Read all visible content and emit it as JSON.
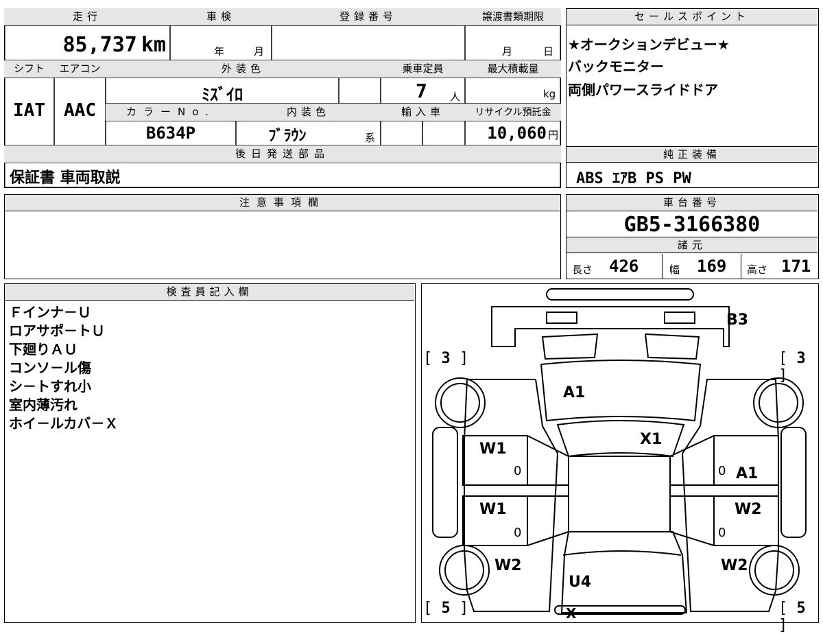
{
  "top_left": {
    "h_mileage": "走行",
    "h_inspection": "車検",
    "h_reg_no": "登録番号",
    "h_transfer_deadline": "譲渡書類期限",
    "mileage": "85,737",
    "mileage_unit": "km",
    "year_label": "年",
    "month_label": "月",
    "deadline_month": "月",
    "deadline_day": "日",
    "h_shift": "シフト",
    "h_aircon": "エアコン",
    "h_exterior": "外装色",
    "h_capacity": "乗車定員",
    "h_max_load": "最大積載量",
    "shift": "IAT",
    "aircon": "AAC",
    "exterior_color": "ﾐｽﾞｲﾛ",
    "capacity": "7",
    "capacity_unit": "人",
    "load_unit": "kg",
    "h_color_no": "カラーNo.",
    "h_interior": "内装色",
    "h_import": "輸入車",
    "h_recycle": "リサイクル預託金",
    "color_no": "B634P",
    "interior_color": "ﾌﾞﾗｳﾝ",
    "interior_suffix": "系",
    "recycle_fee": "10,060",
    "recycle_unit": "円",
    "h_later_parts": "後日発送部品",
    "later_parts": "保証書 車両取説"
  },
  "sales": {
    "h_sales_points": "セールスポイント",
    "points": [
      "★オークションデビュー★",
      "バックモニター",
      "両側パワースライドドア"
    ],
    "h_standard": "純正装備",
    "standard_equipment": "ABS ｴｱB PS PW"
  },
  "notes": {
    "h_notes": "注意事項欄"
  },
  "chassis": {
    "h_chassis": "車台番号",
    "chassis_no": "GB5-3166380",
    "h_specs": "諸元",
    "length_label": "長さ",
    "length": "426",
    "width_label": "幅",
    "width": "169",
    "height_label": "高さ",
    "height": "171"
  },
  "inspector": {
    "h_inspector": "検査員記入欄",
    "lines": [
      "Ｆインナ－Ｕ",
      "ロアサポ－トＵ",
      "下廻りＡＵ",
      "コンソ－ル傷",
      "シ－トすれ小",
      "室内薄汚れ",
      "ホイ－ルカバ－Ｘ"
    ]
  },
  "diagram": {
    "b_rear": "B3",
    "tread_fl": "3",
    "tread_fr": "3",
    "tread_rl": "5",
    "tread_rr": "5",
    "roof": "A1",
    "hood": "X1",
    "left_front_door": "W1",
    "left_rear_door": "W1",
    "right_front_door": "A1",
    "right_rear_door": "W2",
    "left_front_fender": "W2",
    "right_front_fender": "W2",
    "front_bumper_area": "U4",
    "front_bumper": "X",
    "zero1": "0",
    "zero2": "0",
    "zero3": "0",
    "zero4": "0"
  }
}
